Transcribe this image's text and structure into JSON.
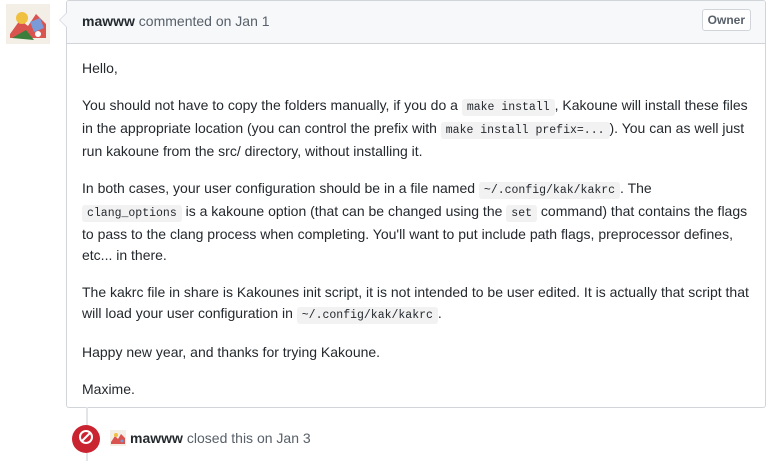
{
  "comment": {
    "author": "mawww",
    "meta": "commented on Jan 1",
    "badge": "Owner",
    "p1": "Hello,",
    "p2": {
      "t1": "You should not have to copy the folders manually, if you do a ",
      "c1": "make install",
      "t2": ", Kakoune will install these files in the appropriate location (you can control the prefix with ",
      "c2": "make install prefix=...",
      "t3": "). You can as well just run kakoune from the src/ directory, without installing it."
    },
    "p3": {
      "t1": "In both cases, your user configuration should be in a file named ",
      "c1": "~/.config/kak/kakrc",
      "t2": ". The ",
      "c2": "clang_options",
      "t3": " is a kakoune option (that can be changed using the ",
      "c3": "set",
      "t4": " command) that contains the flags to pass to the clang process when completing. You'll want to put include path flags, preprocessor defines, etc... in there."
    },
    "p4": {
      "t1": "The kakrc file in share is Kakounes init script, it is not intended to be user edited. It is actually that script that will load your user configuration in ",
      "c1": "~/.config/kak/kakrc",
      "t2": "."
    },
    "p5": "Happy new year, and thanks for trying Kakoune.",
    "p6": "Maxime."
  },
  "event": {
    "author": "mawww",
    "text": "closed this on Jan 3",
    "icon": "circle-slash-icon",
    "color": "#cb2431"
  }
}
